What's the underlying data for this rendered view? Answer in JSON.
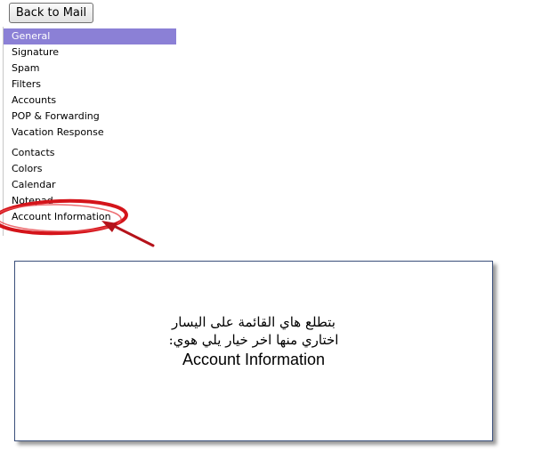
{
  "toolbar": {
    "back_label": "Back to Mail"
  },
  "menu": {
    "group1": [
      {
        "label": "General",
        "selected": true
      },
      {
        "label": "Signature"
      },
      {
        "label": "Spam"
      },
      {
        "label": "Filters"
      },
      {
        "label": "Accounts"
      },
      {
        "label": "POP & Forwarding"
      },
      {
        "label": "Vacation Response"
      }
    ],
    "group2": [
      {
        "label": "Contacts"
      },
      {
        "label": "Colors"
      },
      {
        "label": "Calendar"
      },
      {
        "label": "Notepad"
      },
      {
        "label": "Account Information"
      }
    ]
  },
  "note": {
    "line1": "بتطلع هاي القائمة على اليسار",
    "line2": "اختاري منها اخر خيار يلي هوي:",
    "line3": "Account Information"
  },
  "colors": {
    "selected_bg": "#8b80d6",
    "highlight_ring": "#d4141a",
    "box_border": "#3a4f7a"
  }
}
